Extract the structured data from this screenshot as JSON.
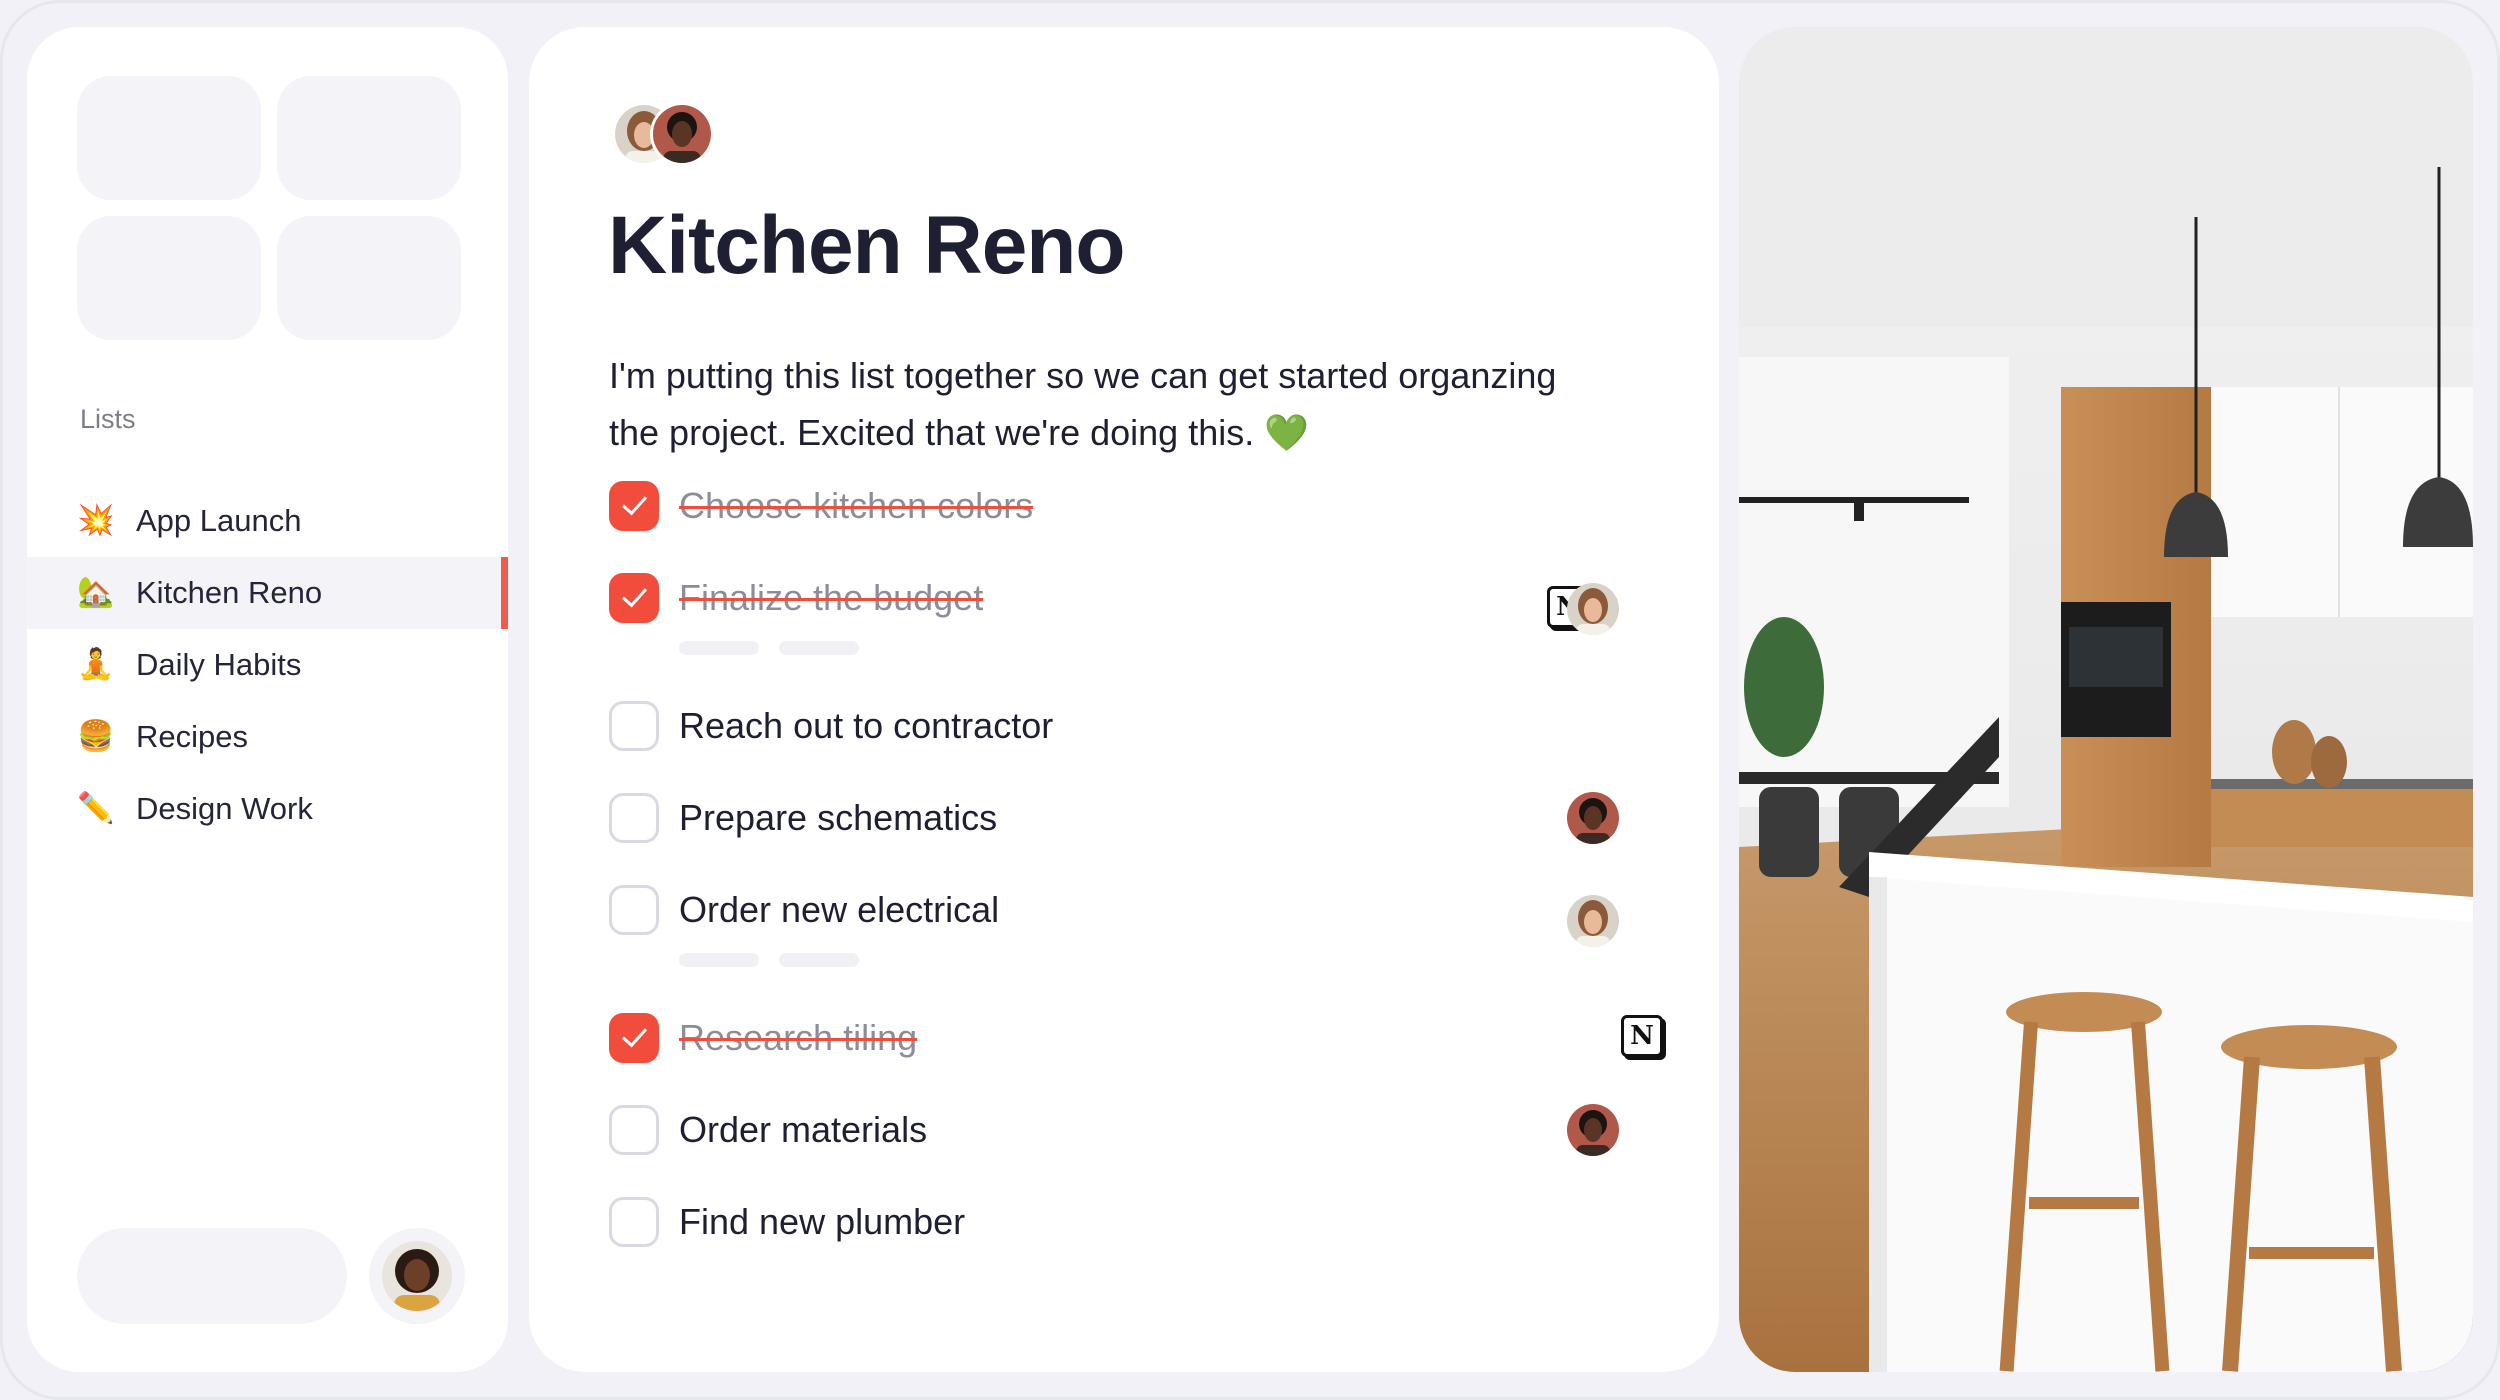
{
  "sidebar": {
    "section_label": "Lists",
    "items": [
      {
        "emoji": "💥",
        "label": "App Launch",
        "active": false
      },
      {
        "emoji": "🏡",
        "label": "Kitchen Reno",
        "active": true
      },
      {
        "emoji": "🧘",
        "label": "Daily Habits",
        "active": false
      },
      {
        "emoji": "🍔",
        "label": "Recipes",
        "active": false
      },
      {
        "emoji": "✏️",
        "label": "Design Work",
        "active": false
      }
    ]
  },
  "main": {
    "title": "Kitchen Reno",
    "description": "I'm putting this list together so we can get started organzing the project. Excited that we're doing this. 💚",
    "tasks": [
      {
        "label": "Choose kitchen colors",
        "done": true
      },
      {
        "label": "Finalize the budget",
        "done": true
      },
      {
        "label": "Reach out to contractor",
        "done": false
      },
      {
        "label": "Prepare schematics",
        "done": false
      },
      {
        "label": "Order new electrical",
        "done": false
      },
      {
        "label": "Research tiling",
        "done": true
      },
      {
        "label": "Order materials",
        "done": false
      },
      {
        "label": "Find new plumber",
        "done": false
      }
    ]
  },
  "icons": {
    "notion": "notion-icon",
    "notion_glyph": "N"
  },
  "colors": {
    "accent": "#f24c3d",
    "background": "#f1f1f7",
    "card": "#ffffff"
  }
}
